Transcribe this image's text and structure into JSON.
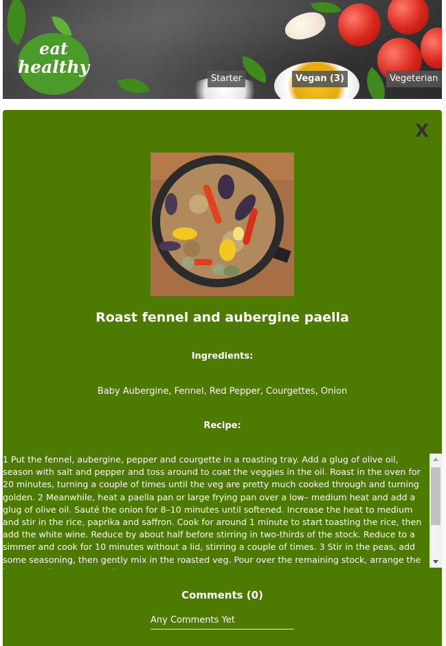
{
  "brand": {
    "logo_line1": "eat",
    "logo_line2": "healthy"
  },
  "nav": {
    "starter": "Starter",
    "vegan": "Vegan (3)",
    "vegetarian": "Vegeterian"
  },
  "modal": {
    "close_label": "X",
    "dish_title": "Roast fennel and aubergine paella",
    "ingredients_heading": "Ingredients:",
    "ingredients": "Baby Aubergine, Fennel, Red Pepper, Courgettes, Onion",
    "recipe_heading": "Recipe:",
    "recipe": "1 Put the fennel, aubergine, pepper and courgette in a roasting tray. Add a glug of olive oil, season with salt and pepper and toss around to coat the veggies in the oil. Roast in the oven for 20 minutes, turning a couple of times until the veg are pretty much cooked through and turning golden. 2 Meanwhile, heat a paella pan or large frying pan over a low– medium heat and add a glug of olive oil. Sauté the onion for 8–10 minutes until softened. Increase the heat to medium and stir in the rice, paprika and saffron. Cook for around 1 minute to start toasting the rice, then add the white wine. Reduce by about half before stirring in two-thirds of the stock. Reduce to a simmer and cook for 10 minutes without a lid, stirring a couple of times. 3 Stir in the peas, add some seasoning, then gently mix in the roasted veg. Pour over the remaining stock, arrange the lemon wedges on top and",
    "comments_heading": "Comments (0)",
    "comments_empty": "Any Comments Yet"
  },
  "colors": {
    "panel": "#4d7a00",
    "logo": "#4a9b2a",
    "nav_tab": "#555555"
  }
}
